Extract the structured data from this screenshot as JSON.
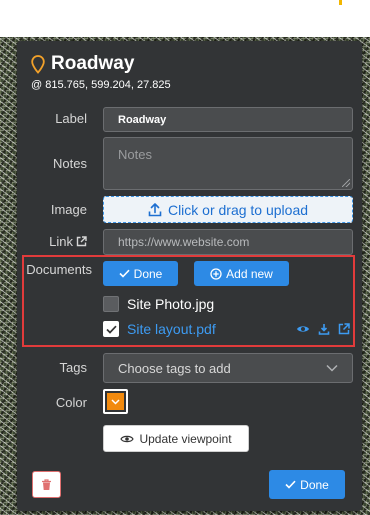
{
  "feature": {
    "title": "Roadway",
    "coords": "@ 815.765, 599.204, 27.825"
  },
  "fields": {
    "label_label": "Label",
    "label_value": "Roadway",
    "notes_label": "Notes",
    "notes_placeholder": "Notes",
    "image_label": "Image",
    "upload_text": "Click or drag to upload",
    "link_label": "Link",
    "link_placeholder": "https://www.website.com"
  },
  "documents": {
    "label": "Documents",
    "done_label": "Done",
    "add_new_label": "Add new",
    "items": [
      {
        "name": "Site Photo.jpg",
        "checked": false
      },
      {
        "name": "Site layout.pdf",
        "checked": true
      }
    ]
  },
  "tags": {
    "label": "Tags",
    "placeholder": "Choose tags to add"
  },
  "color": {
    "label": "Color",
    "value": "#f28a0e"
  },
  "actions": {
    "update_viewpoint_label": "Update viewpoint",
    "done_label": "Done"
  },
  "theme": {
    "accent": "#2d8ae5",
    "highlight_border": "#e23b3b",
    "panel_bg": "#323436"
  }
}
